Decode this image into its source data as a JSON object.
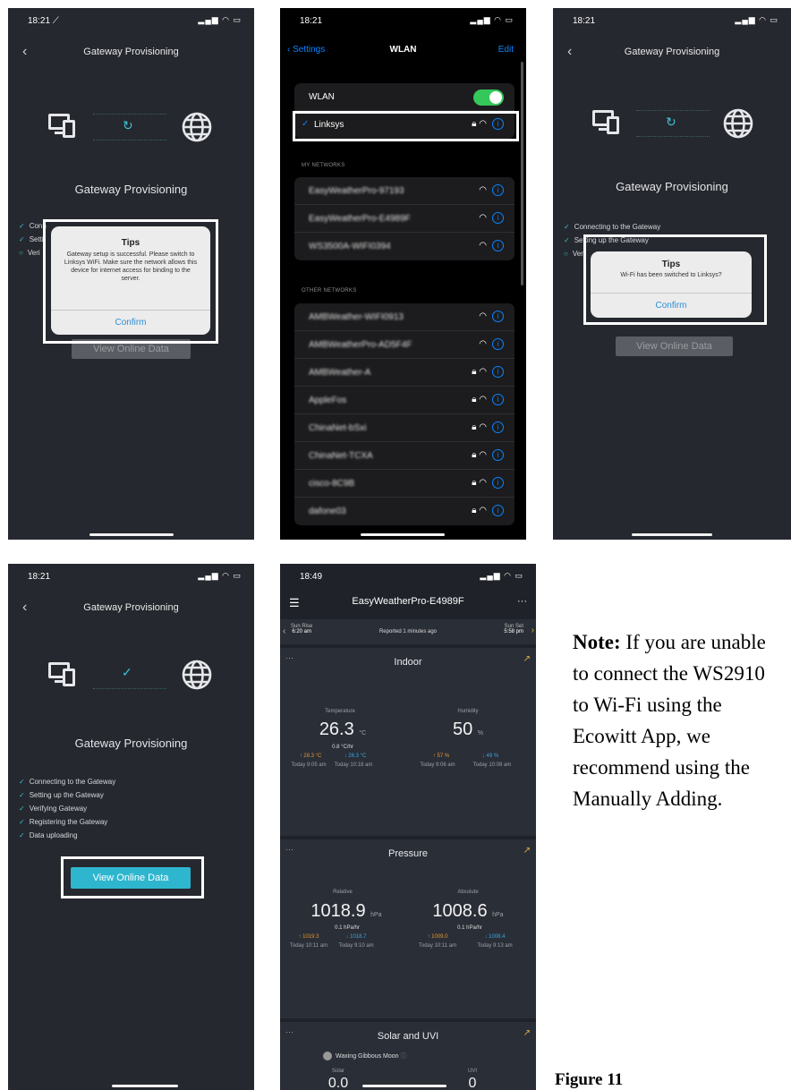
{
  "colors": {
    "accent": "#3ec2d7",
    "ios_blue": "#0a84ff",
    "toggle_green": "#34c759",
    "button_cyan": "#2fb6cf"
  },
  "screen1": {
    "time": "18:21 ⟋",
    "title": "Gateway Provisioning",
    "heading": "Gateway Provisioning",
    "steps": [
      "Conn",
      "Setti",
      "Veri"
    ],
    "dialog": {
      "title": "Tips",
      "message": "Gateway setup is successful. Please switch to Linksys WiFi. Make sure the network allows this device for internet access for binding to the server.",
      "confirm": "Confirm"
    },
    "button": "View Online Data"
  },
  "screen2": {
    "time": "18:21",
    "back": "Settings",
    "title": "WLAN",
    "edit": "Edit",
    "wlan_label": "WLAN",
    "connected": "Linksys",
    "my_networks_header": "MY NETWORKS",
    "my_networks": [
      "EasyWeatherPro-97193",
      "EasyWeatherPro-E4989F",
      "WS3500A-WIFI0394"
    ],
    "other_networks_header": "OTHER NETWORKS",
    "other_networks": [
      "AMBWeather-WIFI0913",
      "AMBWeatherPro-AD5F4F",
      "AMBWeather-A",
      "AppleFos",
      "ChinaNet-bSxi",
      "ChinaNet-TCXA",
      "cisco-8C9B",
      "dafone03"
    ]
  },
  "screen3": {
    "time": "18:21",
    "title": "Gateway Provisioning",
    "heading": "Gateway Provisioning",
    "steps": [
      "Connecting to the Gateway",
      "Setting up the Gateway",
      "Veri"
    ],
    "dialog": {
      "title": "Tips",
      "message": "Wi-Fi has been switched to Linksys?",
      "confirm": "Confirm"
    },
    "button": "View Online Data"
  },
  "screen4": {
    "time": "18:21",
    "title": "Gateway Provisioning",
    "heading": "Gateway Provisioning",
    "steps": [
      "Connecting to the Gateway",
      "Setting up the Gateway",
      "Verifying Gateway",
      "Registering the Gateway",
      "Data uploading"
    ],
    "button": "View Online Data"
  },
  "screen5": {
    "time": "18:49",
    "title": "EasyWeatherPro-E4989F",
    "sunrise_label": "Sun Rise",
    "sunrise": "6:20 am",
    "sunset_label": "Sun Set",
    "sunset": "5:58 pm",
    "reported": "Reported 1 minutes ago",
    "indoor": {
      "title": "Indoor",
      "temp_label": "Temperature",
      "temp": "26.3",
      "temp_unit": "°C",
      "temp_rate": "0.8 °C/hr",
      "temp_hi": "↑ 28.3 °C",
      "temp_lo": "↓ 26.3 °C",
      "temp_hi_time": "Today 9:05 am",
      "temp_lo_time": "Today 10:18 am",
      "hum_label": "Humidity",
      "hum": "50",
      "hum_unit": "%",
      "hum_hi": "↑ 57 %",
      "hum_lo": "↓ 49 %",
      "hum_hi_time": "Today 9:06 am",
      "hum_lo_time": "Today 10:08 am"
    },
    "pressure": {
      "title": "Pressure",
      "rel_label": "Relative",
      "rel": "1018.9",
      "rel_unit": "hPa",
      "rel_rate": "0.1 hPa/hr",
      "rel_hi": "↑ 1019.3",
      "rel_lo": "↓ 1018.7",
      "rel_hi_time": "Today 10:11 am",
      "rel_lo_time": "Today 9:10 am",
      "abs_label": "Absolute",
      "abs": "1008.6",
      "abs_unit": "hPa",
      "abs_rate": "0.1 hPa/hr",
      "abs_hi": "↑ 1009.0",
      "abs_lo": "↓ 1008.4",
      "abs_hi_time": "Today 10:11 am",
      "abs_lo_time": "Today 9:13 am"
    },
    "solar": {
      "title": "Solar and UVI",
      "moon": "Waxing Gibbous Moon",
      "solar_label": "Solar",
      "solar": "0.0",
      "uvi_label": "UVI",
      "uvi": "0"
    }
  },
  "note": {
    "bold": "Note:",
    "text": " If you are unable to connect the WS2910 to Wi-Fi using the Ecowitt App, we recommend using the Manually Adding."
  },
  "figure": "Figure 11"
}
